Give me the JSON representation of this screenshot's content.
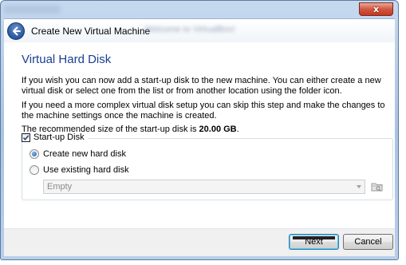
{
  "window": {
    "blurred_title": "Welcome to VirtualBox!",
    "close_glyph": "x"
  },
  "wizard": {
    "title": "Create New Virtual Machine",
    "back_icon": "back-arrow-icon"
  },
  "page": {
    "heading": "Virtual Hard Disk",
    "paragraph1": "If you wish you can now add a start-up disk to the new machine. You can either create a new virtual disk or select one from the list or from another location using the folder icon.",
    "paragraph2": "If you need a more complex virtual disk setup you can skip this step and make the changes to the machine settings once the machine is created.",
    "recommended_prefix": "The recommended size of the start-up disk is ",
    "recommended_size": "20.00 GB",
    "recommended_suffix": "."
  },
  "startup_disk": {
    "label": "Start-up Disk",
    "checked": true,
    "options": [
      {
        "label": "Create new hard disk",
        "selected": true
      },
      {
        "label": "Use existing hard disk",
        "selected": false
      }
    ],
    "existing_disk_select": {
      "value": "Empty",
      "enabled": false
    },
    "folder_icon": "folder-icon"
  },
  "buttons": {
    "next": "Next",
    "cancel": "Cancel"
  },
  "colors": {
    "heading": "#1a3f8f",
    "accent": "#3c7fb1",
    "close": "#c23a22"
  }
}
